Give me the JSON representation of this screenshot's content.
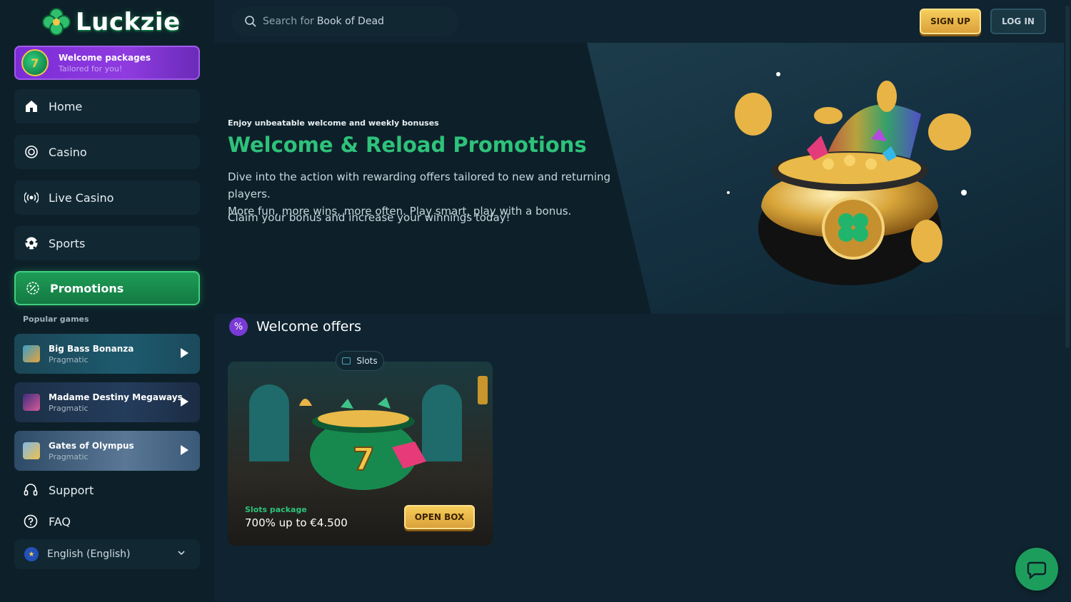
{
  "brand": {
    "name": "Luckzie"
  },
  "header": {
    "search_prefix": "Search for",
    "search_term": "Book of Dead",
    "signup_label": "SIGN UP",
    "login_label": "LOG IN"
  },
  "sidebar": {
    "welcome": {
      "title": "Welcome packages",
      "subtitle": "Tailored for you!"
    },
    "nav": [
      {
        "label": "Home",
        "icon": "home-icon"
      },
      {
        "label": "Casino",
        "icon": "casino-chip-icon"
      },
      {
        "label": "Live Casino",
        "icon": "live-broadcast-icon"
      },
      {
        "label": "Sports",
        "icon": "soccer-ball-icon"
      },
      {
        "label": "Promotions",
        "icon": "percent-badge-icon",
        "active": true
      }
    ],
    "popular_label": "Popular games",
    "games": [
      {
        "name": "Big Bass Bonanza",
        "provider": "Pragmatic"
      },
      {
        "name": "Madame Destiny Megaways",
        "provider": "Pragmatic"
      },
      {
        "name": "Gates of Olympus",
        "provider": "Pragmatic"
      }
    ],
    "support_label": "Support",
    "faq_label": "FAQ",
    "language": "English (English)"
  },
  "hero": {
    "kicker": "Enjoy unbeatable welcome and weekly bonuses",
    "title": "Welcome & Reload Promotions",
    "desc_line1": "Dive into the action with rewarding offers tailored to new and returning players.",
    "desc_line2": "More fun, more wins, more often. Play smart, play with a bonus.",
    "claim": "Claim your bonus and increase your winnings today!"
  },
  "offers": {
    "title": "Welcome offers",
    "card": {
      "tag": "Slots",
      "subtitle": "Slots package",
      "amount": "700% up to €4.500",
      "button": "OPEN BOX"
    }
  },
  "colors": {
    "accent_green": "#2ec27a",
    "gold": "#f6cd5b",
    "purple": "#8f3be0",
    "background": "#0f2430"
  }
}
